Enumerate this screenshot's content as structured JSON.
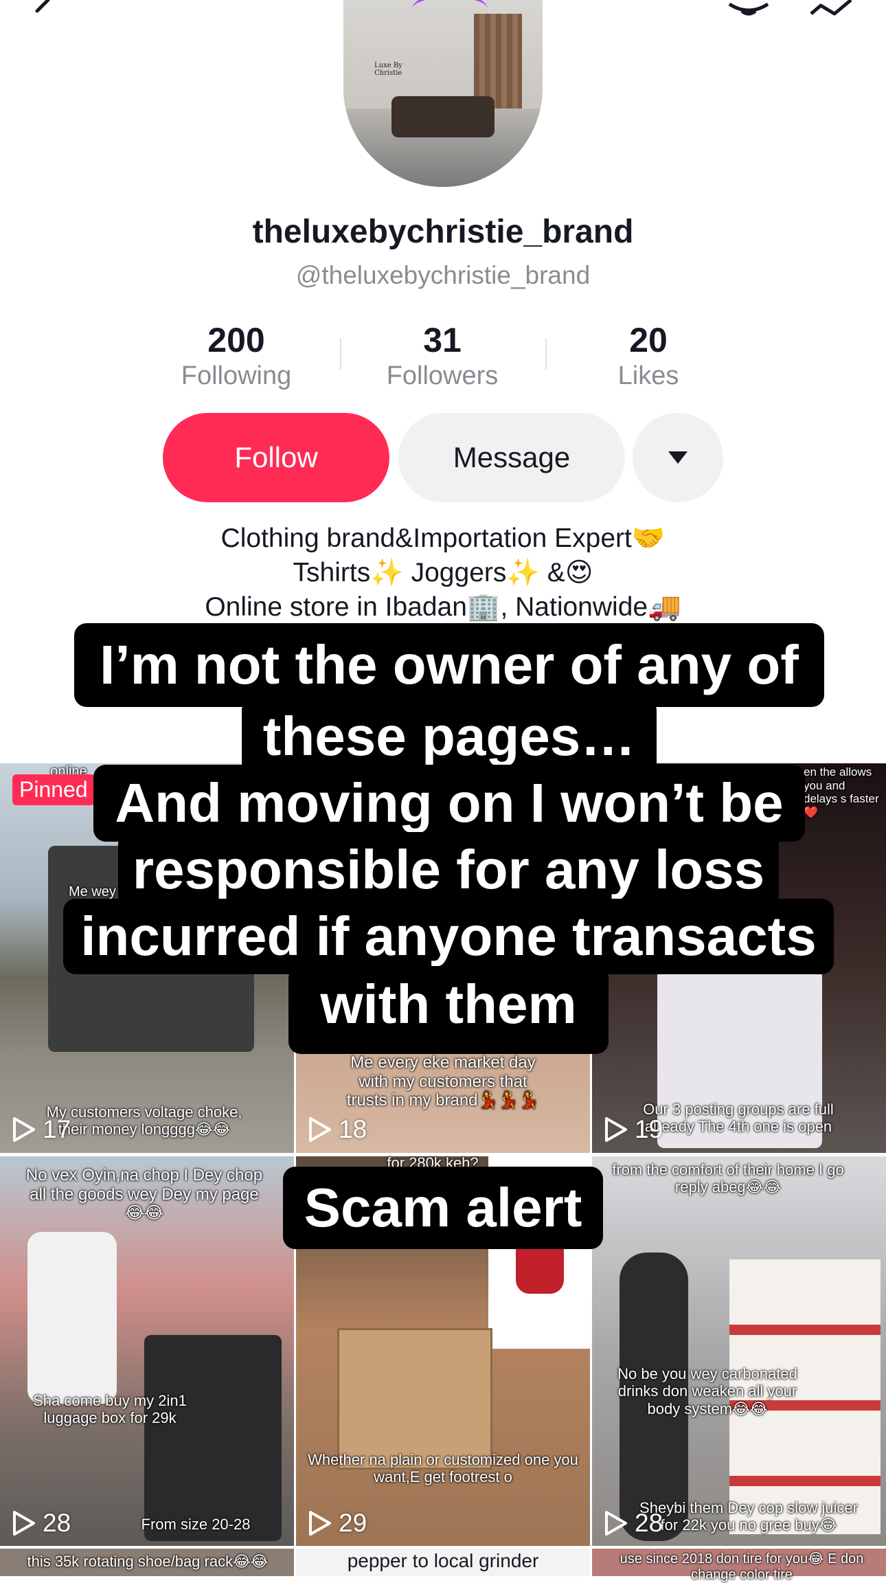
{
  "profile": {
    "display_name": "theluxebychristie_brand",
    "handle": "@theluxebychristie_brand",
    "avatar_text": "Luxe By Christie"
  },
  "stats": [
    {
      "value": "200",
      "label": "Following"
    },
    {
      "value": "31",
      "label": "Followers"
    },
    {
      "value": "20",
      "label": "Likes"
    }
  ],
  "actions": {
    "follow_label": "Follow",
    "message_label": "Message"
  },
  "bio": {
    "line1": "Clothing brand&Importation Expert🤝",
    "line2": "Tshirts✨ Joggers✨ &😍",
    "line3": "Online store in Ibadan🏢, Nationwide🚚"
  },
  "overlay": {
    "line1": "I’m not the owner of any of",
    "line2": "these pages…",
    "line3": "And moving on I won’t be",
    "line4": "responsible for any loss",
    "line5": "incurred if anyone transacts",
    "line6": "with them",
    "scam": "Scam alert"
  },
  "pinned_label": "Pinned",
  "videos": [
    {
      "views": "17",
      "top_text": "online",
      "mid_text": "Me wey",
      "caption": "My customers voltage choke, their money longggg😂😂"
    },
    {
      "views": "18",
      "top_text": "",
      "mid_text": "",
      "caption": "Me every eke market day with my customers that trusts in my brand💃💃💃"
    },
    {
      "views": "19",
      "top_text": "en the allows you and delays s faster❤️",
      "mid_text": "",
      "caption": "Our 3 posting groups are full already The 4th one is open"
    },
    {
      "views": "28",
      "top_text": "No vex Oyin,na chop I Dey chop all the goods wey Dey my page😂😂",
      "mid_text": "",
      "caption": "Sha come buy my 2in1 luggage box for 29k",
      "extra": "From size 20-28"
    },
    {
      "views": "29",
      "top_text": "for 280k keh?",
      "mid_text": "",
      "caption": "Whether na plain or customized one you want,E get footrest o"
    },
    {
      "views": "28",
      "top_text": "from the comfort of their home I go reply abeg😂😂",
      "mid_text": "No be you wey carbonated drinks don weaken all your body system😂😂",
      "caption": "Sheybi them Dey cop slow juicer for 22k you no gree buy😂"
    }
  ],
  "bottom_row": [
    "this 35k rotating shoe/bag rack😂😂",
    "pepper to local grinder",
    "use since 2018 don tire for you😂 E don change color tire"
  ]
}
